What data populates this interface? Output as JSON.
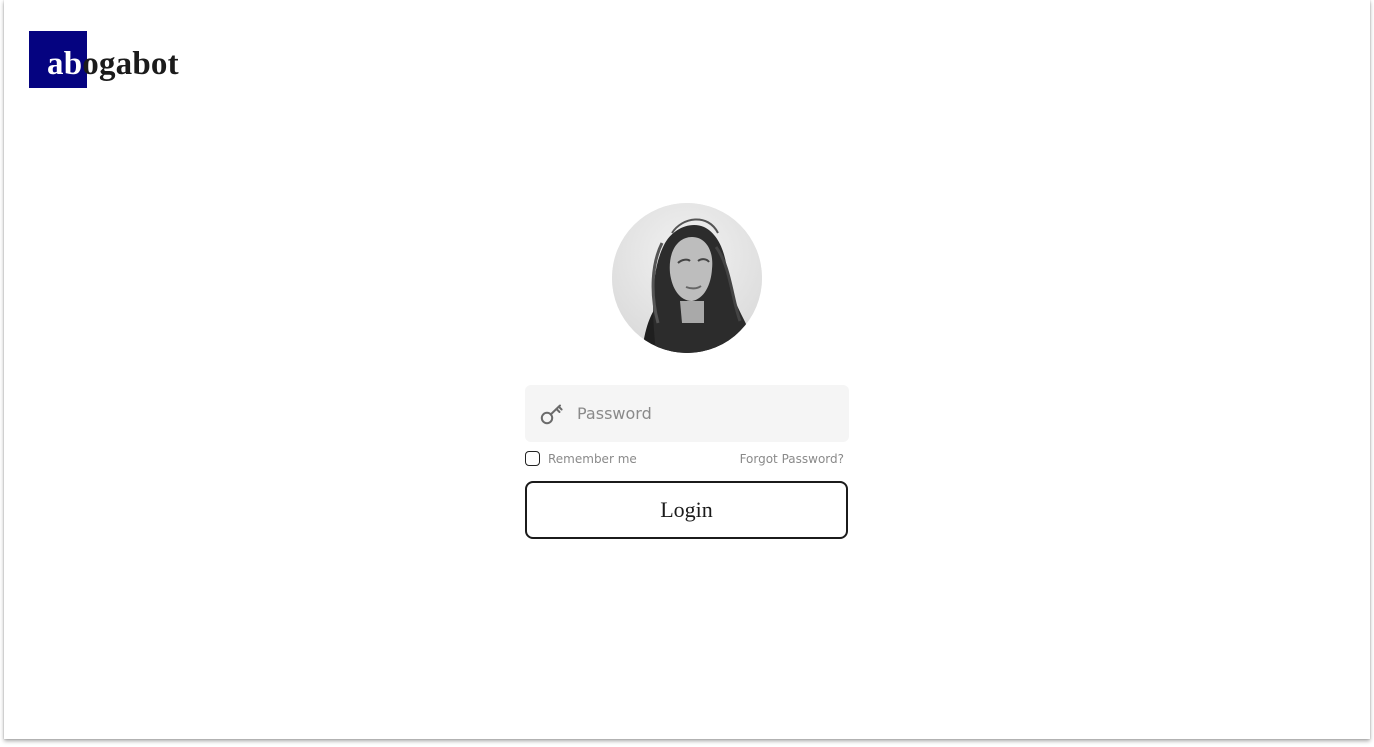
{
  "brand": {
    "logo_highlight": "ab",
    "logo_rest": "ogabot",
    "accent_color": "#050380"
  },
  "avatar": {
    "icon": "user-avatar-photo"
  },
  "login_form": {
    "password_placeholder": "Password",
    "password_value": "",
    "password_icon": "key-icon",
    "remember_label": "Remember me",
    "remember_checked": false,
    "forgot_label": "Forgot Password?",
    "login_label": "Login"
  }
}
